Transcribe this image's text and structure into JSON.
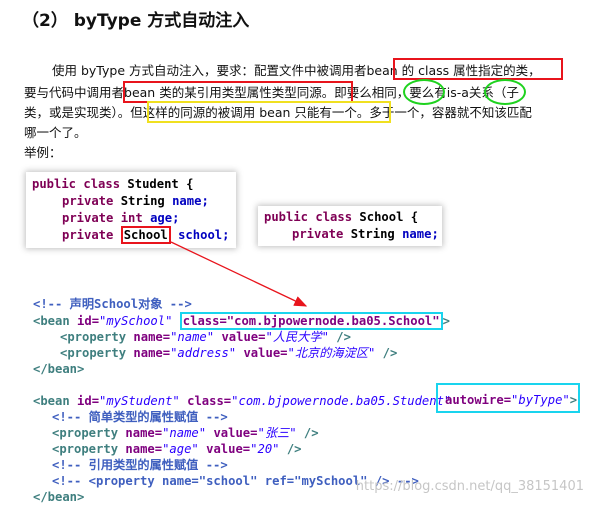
{
  "heading": "（2） byType 方式自动注入",
  "paragraph": {
    "line1a": "使用 byType 方式自动注入，要求：配置文件中被调用者",
    "line1_hl_red1": "bean 的 class 属性指定的类",
    "line1b": "，",
    "line2a": "要与代码中调用者",
    "line2_hl_red2": "bean 类的某引用类型属性类型同源",
    "line2b": "。即要么",
    "line2_hl_green1": "相同",
    "line2c": "，要么有",
    "line2_hl_green2": "is-a",
    "line2d": "关系（子",
    "line3a": "类，或是实现类）。但",
    "line3_hl_yellow": "这样的同源的被调用 bean 只能有一个",
    "line3b": "。多于一个，容器就不知该匹配",
    "line4": "哪一个了。",
    "example_label": "举例："
  },
  "student_class": {
    "l1_kw": "public class",
    "l1_name": "Student",
    "l1_brace": "{",
    "f1_kw": "private",
    "f1_type": "String",
    "f1_name": "name;",
    "f2_kw": "private",
    "f2_type": "int",
    "f2_name": "age;",
    "f3_kw": "private",
    "f3_type": "School",
    "f3_name": "school;"
  },
  "school_class": {
    "l1_kw": "public class",
    "l1_name": "School",
    "l1_brace": "{",
    "f1_kw": "private",
    "f1_type": "String",
    "f1_name": "name;"
  },
  "xml": {
    "c1": "<!-- 声明School对象 -->",
    "b1_open": "<bean",
    "b1_id_attr": "id=",
    "b1_id_val": "\"mySchool\"",
    "b1_class": "class=\"com.bjpowernode.ba05.School\"",
    "b1_close": ">",
    "p1_open": "<property",
    "p1_name_attr": "name=",
    "p1_name_val": "\"name\"",
    "p1_value_attr": "value=",
    "p1_value_val": "\"人民大学\"",
    "p1_close": "/>",
    "p2_open": "<property",
    "p2_name_attr": "name=",
    "p2_name_val": "\"address\"",
    "p2_value_attr": "value=",
    "p2_value_val": "\"北京的海淀区\"",
    "p2_close": "/>",
    "b1_end": "</bean>",
    "b2_open": "<bean",
    "b2_id_attr": "id=",
    "b2_id_val": "\"myStudent\"",
    "b2_class_attr": "class=",
    "b2_class_val": "\"com.bjpowernode.ba05.Student\"",
    "b2_autowire_attr": "autowire=",
    "b2_autowire_val": "\"byType\"",
    "b2_close": ">",
    "c2": "<!-- 简单类型的属性赋值 -->",
    "p3_open": "<property",
    "p3_name_attr": "name=",
    "p3_name_val": "\"name\"",
    "p3_value_attr": "value=",
    "p3_value_val": "\"张三\"",
    "p3_close": "/>",
    "p4_open": "<property",
    "p4_name_attr": "name=",
    "p4_name_val": "\"age\"",
    "p4_value_attr": "value=",
    "p4_value_val": "\"20\"",
    "p4_close": "/>",
    "c3": "<!-- 引用类型的属性赋值 -->",
    "c4": "<!-- <property name=\"school\" ref=\"mySchool\" /> -->",
    "b2_end": "</bean>"
  },
  "watermark": "https://blog.csdn.net/qq_38151401",
  "colors": {
    "red_box": "#e8141c",
    "green_box": "#1ed21e",
    "yellow_box": "#f0e020",
    "cyan_box": "#19d4ee",
    "arrow": "#e8141c"
  }
}
